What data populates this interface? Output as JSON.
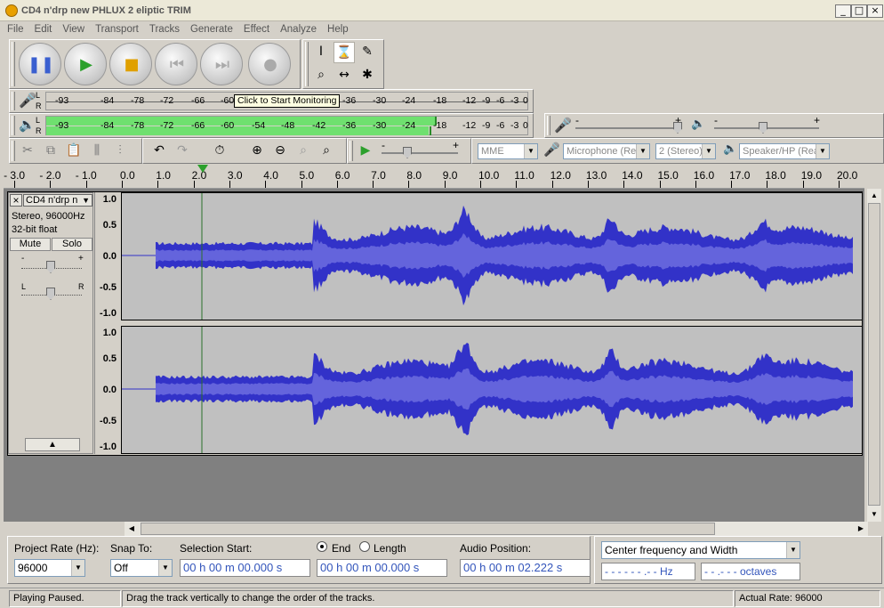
{
  "window": {
    "title": "CD4 n'drp new PHLUX 2 eliptic TRIM"
  },
  "menu": [
    "File",
    "Edit",
    "View",
    "Transport",
    "Tracks",
    "Generate",
    "Effect",
    "Analyze",
    "Help"
  ],
  "transport": {
    "pause_icon": "pause-icon",
    "play_icon": "play-icon",
    "stop_icon": "stop-icon",
    "skip_start_icon": "skip-start-icon",
    "skip_end_icon": "skip-end-icon",
    "record_icon": "record-icon"
  },
  "tools": [
    "I",
    "⌛",
    "✎",
    "⌕",
    "↔",
    "✱"
  ],
  "meters": {
    "record_scale": [
      "-93",
      "-84",
      "-78",
      "-72",
      "-66",
      "-60",
      "-36",
      "-30",
      "-24",
      "-18",
      "-12",
      "-9",
      "-6",
      "-3",
      "0"
    ],
    "tooltip": "Click to Start Monitoring",
    "play_scale": [
      "-93",
      "-84",
      "-78",
      "-72",
      "-66",
      "-60",
      "-54",
      "-48",
      "-42",
      "-36",
      "-30",
      "-24",
      "-18",
      "-12",
      "-9",
      "-6",
      "-3",
      "0"
    ],
    "channel_l": "L",
    "channel_r": "R"
  },
  "mixer": {
    "minus": "-",
    "plus": "+"
  },
  "device": {
    "host": "MME",
    "input": "Microphone (Rea",
    "channels": "2 (Stereo)",
    "output": "Speaker/HP (Rea"
  },
  "ruler": [
    "- 3.0",
    "- 2.0",
    "- 1.0",
    "0.0",
    "1.0",
    "2.0",
    "3.0",
    "4.0",
    "5.0",
    "6.0",
    "7.0",
    "8.0",
    "9.0",
    "10.0",
    "11.0",
    "12.0",
    "13.0",
    "14.0",
    "15.0",
    "16.0",
    "17.0",
    "18.0",
    "19.0",
    "20.0"
  ],
  "track": {
    "name": "CD4 n'drp n",
    "info1": "Stereo, 96000Hz",
    "info2": "32-bit float",
    "mute": "Mute",
    "solo": "Solo",
    "gain_minus": "-",
    "gain_plus": "+",
    "pan_l": "L",
    "pan_r": "R",
    "close": "×",
    "menu_arrow": "▼",
    "collapse": "▲",
    "vscale": [
      "1.0",
      "0.5",
      "0.0",
      "-0.5",
      "-1.0"
    ]
  },
  "bottom": {
    "project_rate_label": "Project Rate (Hz):",
    "project_rate": "96000",
    "snap_label": "Snap To:",
    "snap": "Off",
    "selection_start_label": "Selection Start:",
    "end_label": "End",
    "length_label": "Length",
    "audio_position_label": "Audio Position:",
    "sel_start": "00 h 00 m 00.000 s",
    "sel_end": "00 h 00 m 00.000 s",
    "audio_pos": "00 h 00 m 02.222 s",
    "spectral_mode": "Center frequency and Width",
    "freq": "- - - - - - .- -  Hz",
    "octaves": "- - .- - -  octaves"
  },
  "status": {
    "state": "Playing Paused.",
    "hint": "Drag the track vertically to change the order of the tracks.",
    "rate": "Actual Rate: 96000"
  },
  "colors": {
    "wave_outer": "#3232c8",
    "wave_inner": "#6464dc",
    "meter_green": "#6fe06f",
    "cursor": "#2a6f2a"
  }
}
